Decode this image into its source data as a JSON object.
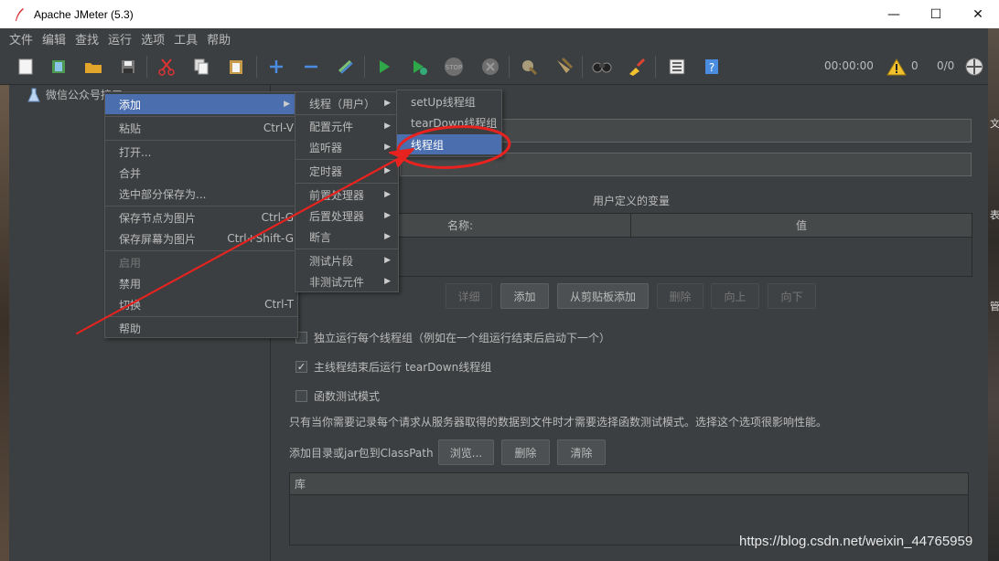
{
  "window": {
    "title": "Apache JMeter (5.3)",
    "min": "—",
    "max": "☐",
    "close": "✕"
  },
  "menubar": [
    "文件",
    "编辑",
    "查找",
    "运行",
    "选项",
    "工具",
    "帮助"
  ],
  "toolbar": {
    "timer": "00:00:00",
    "warning_count": "0",
    "thread_ratio": "0/0"
  },
  "tree": {
    "root": "微信公众号接口"
  },
  "context_menu": {
    "items": [
      {
        "label": "添加",
        "shortcut": "",
        "submenu": true,
        "selected": true
      },
      {
        "label": "粘贴",
        "shortcut": "Ctrl-V"
      },
      {
        "label": "打开..."
      },
      {
        "label": "合并"
      },
      {
        "label": "选中部分保存为..."
      },
      {
        "label": "保存节点为图片",
        "shortcut": "Ctrl-G"
      },
      {
        "label": "保存屏幕为图片",
        "shortcut": "Ctrl+Shift-G"
      },
      {
        "label": "启用",
        "disabled": true
      },
      {
        "label": "禁用"
      },
      {
        "label": "切换",
        "shortcut": "Ctrl-T"
      },
      {
        "label": "帮助"
      }
    ]
  },
  "add_submenu": [
    "线程（用户）",
    "配置元件",
    "监听器",
    "定时器",
    "前置处理器",
    "后置处理器",
    "断言",
    "测试片段",
    "非测试元件"
  ],
  "thread_submenu": [
    "setUp线程组",
    "tearDown线程组",
    "线程组"
  ],
  "content": {
    "vars_title": "用户定义的变量",
    "col_name": "名称:",
    "col_value": "值",
    "buttons": {
      "detail": "详细",
      "add": "添加",
      "add_clipboard": "从剪贴板添加",
      "delete": "删除",
      "up": "向上",
      "down": "向下"
    },
    "chk_independent": "独立运行每个线程组（例如在一个组运行结束后启动下一个）",
    "chk_teardown": "主线程结束后运行 tearDown线程组",
    "chk_functional": "函数测试模式",
    "functional_note": "只有当你需要记录每个请求从服务器取得的数据到文件时才需要选择函数测试模式。选择这个选项很影响性能。",
    "classpath_label": "添加目录或jar包到ClassPath",
    "browse": "浏览...",
    "cp_delete": "删除",
    "cp_clear": "清除",
    "lib_header": "库"
  },
  "watermark": "https://blog.csdn.net/weixin_44765959",
  "desktop_chars": [
    "文",
    "表",
    "管"
  ],
  "colors": {
    "background": "#3c3f41",
    "selection": "#4b6eaf",
    "annotation": "#e8231f"
  }
}
